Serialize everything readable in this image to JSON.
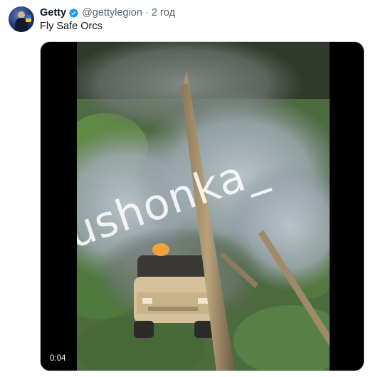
{
  "tweet": {
    "author_name": "Getty",
    "handle": "@gettylegion",
    "separator": "·",
    "time": "2 год",
    "text": "Fly Safe Orcs"
  },
  "media": {
    "watermark": "ushonka_",
    "duration": "0:04"
  },
  "colors": {
    "verified_blue": "#1d9bf0",
    "secondary_text": "#536471",
    "primary_text": "#0f1419"
  },
  "icons": [
    "verified-badge-icon"
  ]
}
